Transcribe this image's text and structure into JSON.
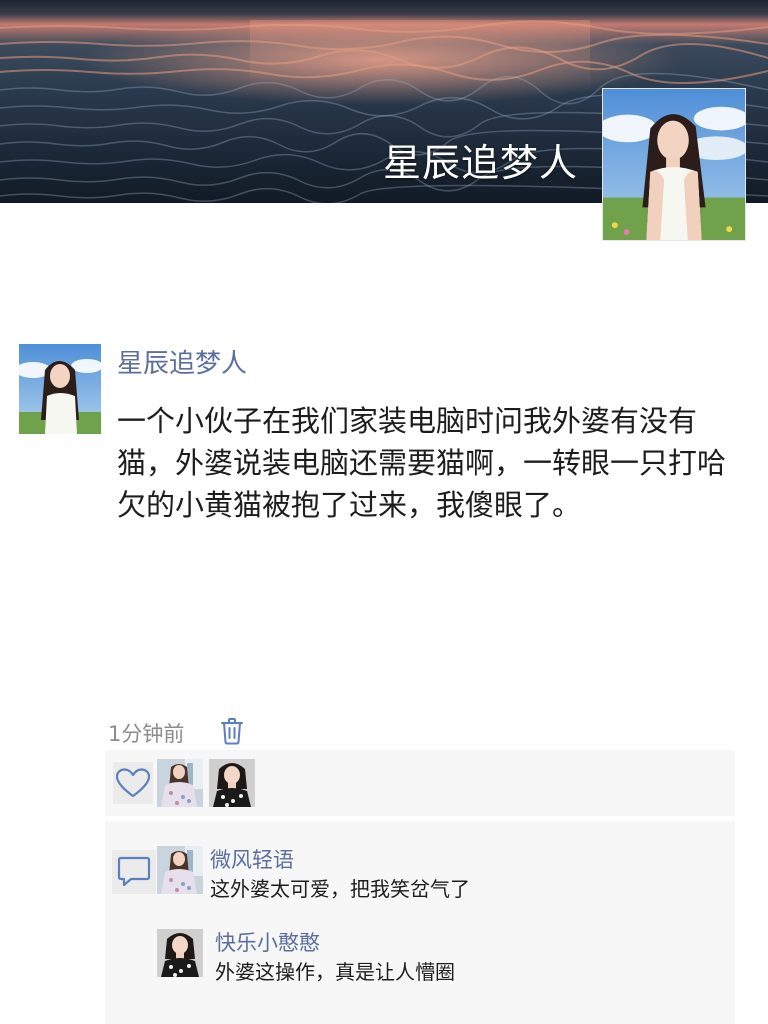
{
  "profile": {
    "name": "星辰追梦人",
    "cover_icon": "sunset-sea-photo",
    "avatar_icon": "girl-portrait-photo"
  },
  "post": {
    "author": "星辰追梦人",
    "text": "一个小伙子在我们家装电脑时问我外婆有没有猫，外婆说装电脑还需要猫啊，一转眼一只打哈欠的小黄猫被抱了过来，我傻眼了。",
    "time": "1分钟前"
  },
  "likes": {
    "icon": "heart-icon",
    "users": [
      {
        "avatar_icon": "girl-floral-dress-avatar"
      },
      {
        "avatar_icon": "girl-qipao-avatar"
      }
    ]
  },
  "comments": {
    "icon": "comment-icon",
    "items": [
      {
        "author": "微风轻语",
        "text": "这外婆太可爱，把我笑岔气了",
        "avatar_icon": "girl-floral-dress-avatar"
      },
      {
        "author": "快乐小憨憨",
        "text": "外婆这操作，真是让人懵圈",
        "avatar_icon": "girl-qipao-avatar"
      }
    ]
  },
  "colors": {
    "name_link": "#5b6f9f",
    "body_text": "#1d1d1d",
    "meta_text": "#8c8c8c",
    "panel_bg": "#f7f7f7",
    "icon_blue": "#5b7fbf"
  }
}
